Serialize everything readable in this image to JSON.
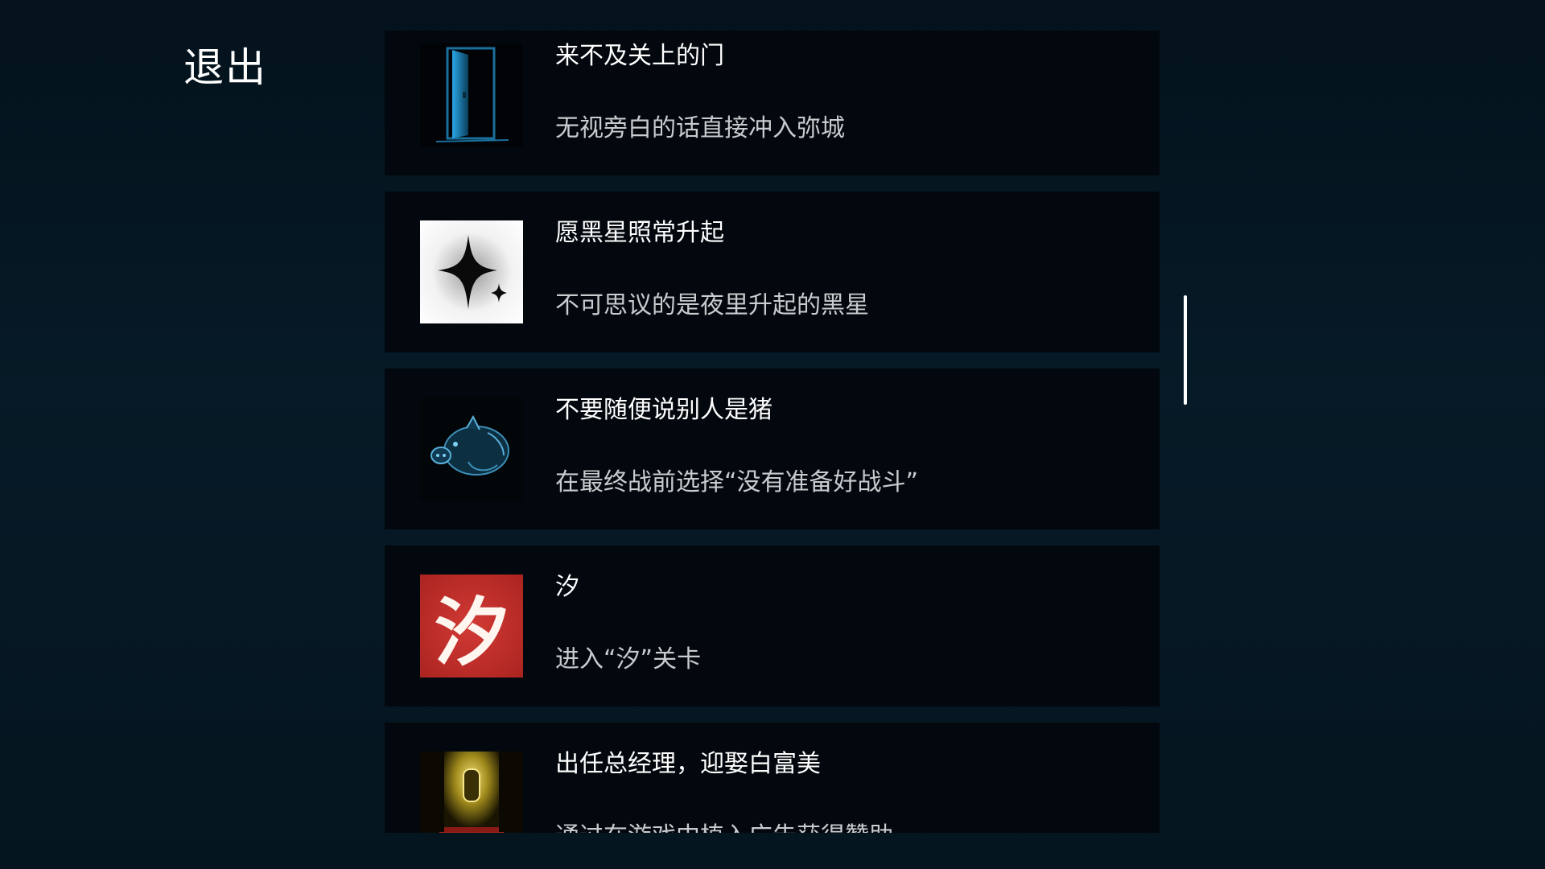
{
  "header": {
    "exit_label": "退出"
  },
  "achievements": [
    {
      "icon": "door-icon",
      "title": "来不及关上的门",
      "description": "无视旁白的话直接冲入弥城"
    },
    {
      "icon": "black-star-icon",
      "title": "愿黑星照常升起",
      "description": "不可思议的是夜里升起的黑星"
    },
    {
      "icon": "pig-icon",
      "title": "不要随便说别人是猪",
      "description": "在最终战前选择“没有准备好战斗”"
    },
    {
      "icon": "xi-character-icon",
      "icon_text": "汐",
      "title": "汐",
      "description": "进入“汐”关卡"
    },
    {
      "icon": "golden-stairway-icon",
      "title": "出任总经理，迎娶白富美",
      "description": "通过在游戏中植入广告获得赞助"
    }
  ],
  "colors": {
    "background": "#04111b",
    "card_background": "#02080d",
    "title_text": "#ffffff",
    "description_text": "#c9ccce",
    "scrollbar_thumb": "#ffffff",
    "xi_icon_red": "#c8302c"
  }
}
